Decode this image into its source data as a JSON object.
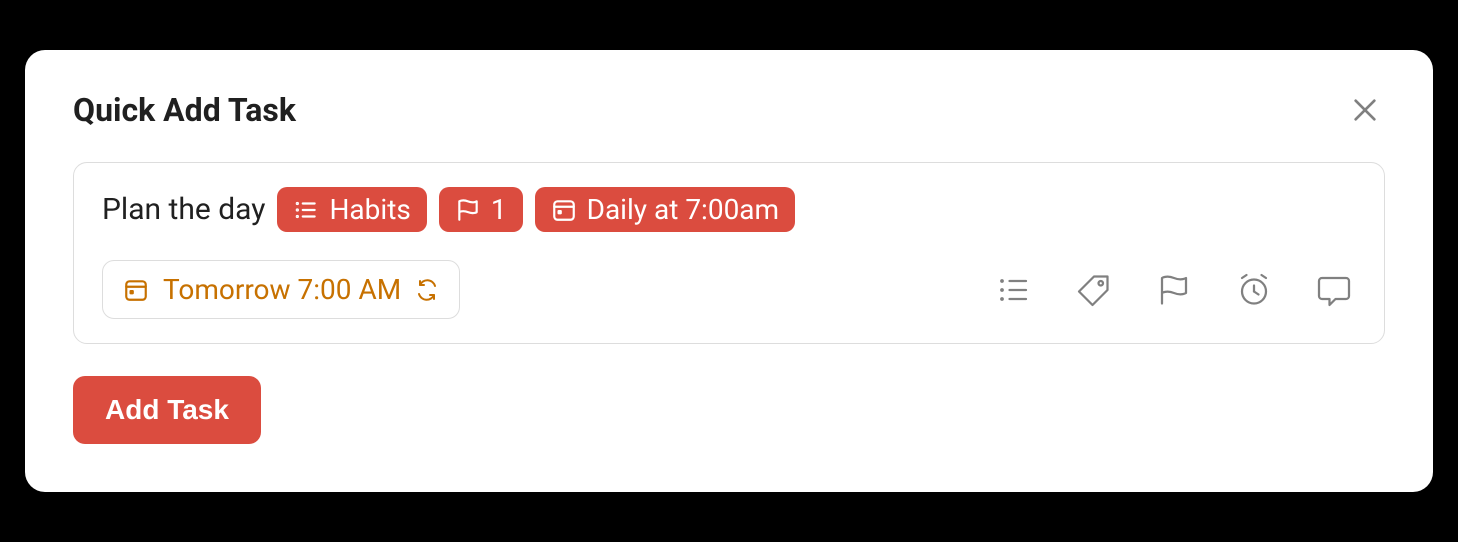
{
  "header": {
    "title": "Quick Add Task"
  },
  "input": {
    "task_text": "Plan the day",
    "chips": {
      "list_chip": {
        "icon": "list-icon",
        "label": "Habits"
      },
      "priority_chip": {
        "icon": "flag-icon",
        "label": "1"
      },
      "schedule_chip": {
        "icon": "calendar-icon",
        "label": "Daily at 7:00am"
      }
    },
    "schedule_pill": {
      "label": "Tomorrow 7:00 AM"
    }
  },
  "actions": {
    "add_button": "Add Task"
  },
  "icons": {
    "list": "list-icon",
    "tag": "tag-icon",
    "flag": "flag-icon",
    "reminder": "alarm-clock-icon",
    "comment": "comment-icon"
  }
}
